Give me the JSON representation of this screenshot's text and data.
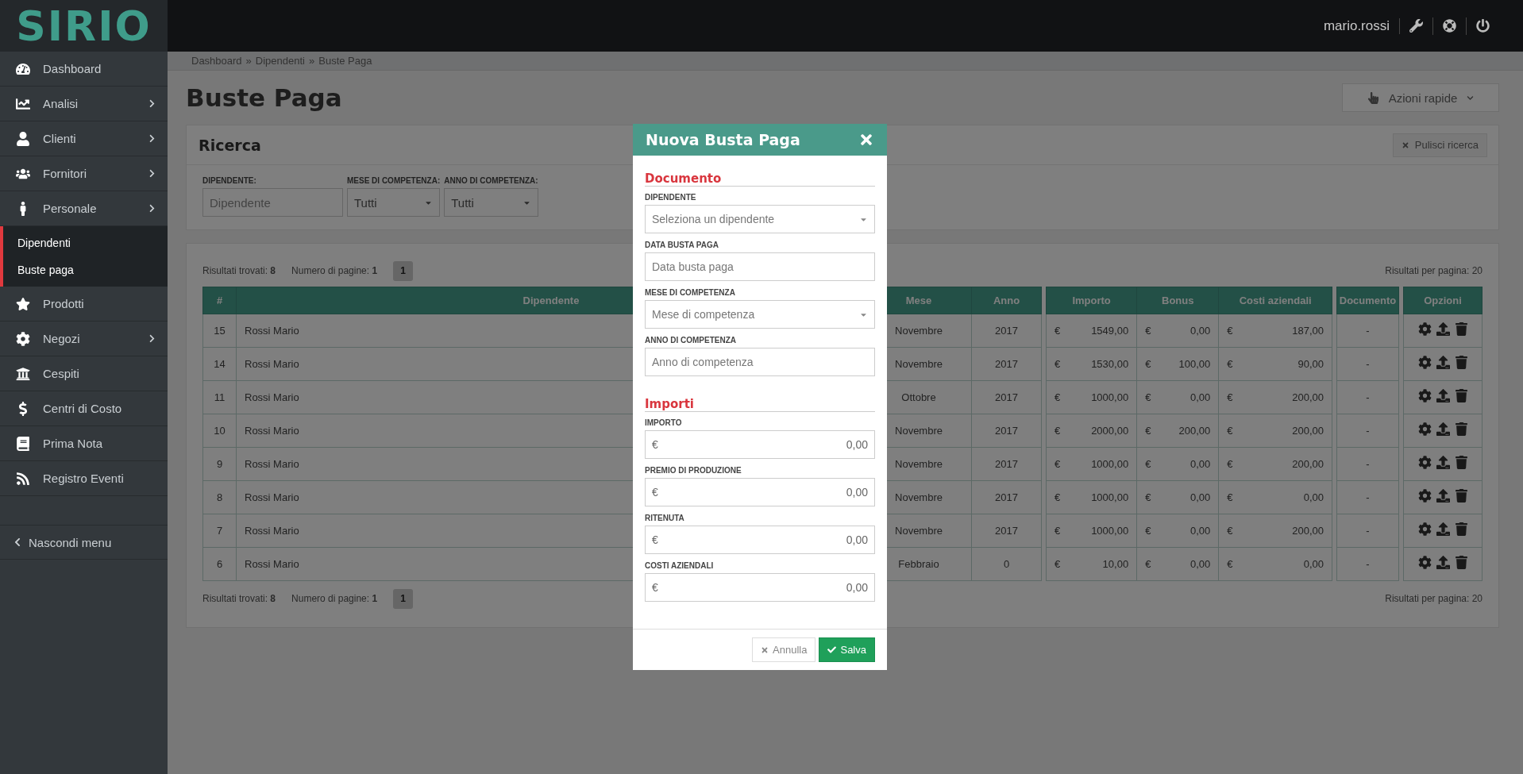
{
  "header": {
    "logo": "SIRIO",
    "user": "mario.rossi"
  },
  "sidebar": {
    "items": [
      {
        "label": "Dashboard",
        "kind": "link"
      },
      {
        "label": "Analisi",
        "kind": "group"
      },
      {
        "label": "Clienti",
        "kind": "group"
      },
      {
        "label": "Fornitori",
        "kind": "group"
      },
      {
        "label": "Personale",
        "kind": "group",
        "children": [
          {
            "label": "Dipendenti"
          },
          {
            "label": "Buste paga"
          }
        ]
      },
      {
        "label": "Prodotti",
        "kind": "link"
      },
      {
        "label": "Negozi",
        "kind": "group"
      },
      {
        "label": "Cespiti",
        "kind": "link"
      },
      {
        "label": "Centri di Costo",
        "kind": "link"
      },
      {
        "label": "Prima Nota",
        "kind": "link"
      },
      {
        "label": "Registro Eventi",
        "kind": "link"
      }
    ],
    "hide_menu": "Nascondi menu"
  },
  "breadcrumb": [
    "Dashboard",
    "Dipendenti",
    "Buste Paga"
  ],
  "breadcrumb_separator": "»",
  "page_title": "Buste Paga",
  "quick_actions": "Azioni rapide",
  "search_panel": {
    "title": "Ricerca",
    "clear_button": "Pulisci ricerca",
    "filters": [
      {
        "label": "DIPENDENTE:",
        "kind": "text",
        "placeholder": "Dipendente"
      },
      {
        "label": "MESE DI COMPETENZA:",
        "kind": "select",
        "value": "Tutti"
      },
      {
        "label": "ANNO DI COMPETENZA:",
        "kind": "select",
        "value": "Tutti"
      }
    ]
  },
  "results_top": {
    "found": "Risultati trovati: **8**",
    "pages": "Numero di pagine: **1**",
    "page_buttons": [
      {
        "label": "1",
        "selected": true
      }
    ],
    "per_page": "Risultati per pagina: 20"
  },
  "table": {
    "groups": [
      [
        "#",
        "Dipendente",
        "Mese",
        "Anno"
      ],
      [
        "Importo",
        "Bonus",
        "Costi aziendali"
      ],
      [
        "Documento"
      ],
      [
        "Opzioni"
      ]
    ],
    "rows": [
      {
        "id": "15",
        "dipendente": "Rossi Mario",
        "mese": "Novembre",
        "anno": "2017",
        "importo": {
          "currency": "€",
          "amount": "1549,00"
        },
        "bonus": {
          "currency": "€",
          "amount": "0,00"
        },
        "costi": {
          "currency": "€",
          "amount": "187,00"
        },
        "documento": "-"
      },
      {
        "id": "14",
        "dipendente": "Rossi Mario",
        "mese": "Novembre",
        "anno": "2017",
        "importo": {
          "currency": "€",
          "amount": "1530,00"
        },
        "bonus": {
          "currency": "€",
          "amount": "100,00"
        },
        "costi": {
          "currency": "€",
          "amount": "90,00"
        },
        "documento": "-"
      },
      {
        "id": "11",
        "dipendente": "Rossi Mario",
        "mese": "Ottobre",
        "anno": "2017",
        "importo": {
          "currency": "€",
          "amount": "1000,00"
        },
        "bonus": {
          "currency": "€",
          "amount": "0,00"
        },
        "costi": {
          "currency": "€",
          "amount": "200,00"
        },
        "documento": "-"
      },
      {
        "id": "10",
        "dipendente": "Rossi Mario",
        "mese": "Novembre",
        "anno": "2017",
        "importo": {
          "currency": "€",
          "amount": "2000,00"
        },
        "bonus": {
          "currency": "€",
          "amount": "200,00"
        },
        "costi": {
          "currency": "€",
          "amount": "200,00"
        },
        "documento": "-"
      },
      {
        "id": "9",
        "dipendente": "Rossi Mario",
        "mese": "Novembre",
        "anno": "2017",
        "importo": {
          "currency": "€",
          "amount": "1000,00"
        },
        "bonus": {
          "currency": "€",
          "amount": "0,00"
        },
        "costi": {
          "currency": "€",
          "amount": "200,00"
        },
        "documento": "-"
      },
      {
        "id": "8",
        "dipendente": "Rossi Mario",
        "mese": "Novembre",
        "anno": "2017",
        "importo": {
          "currency": "€",
          "amount": "1000,00"
        },
        "bonus": {
          "currency": "€",
          "amount": "0,00"
        },
        "costi": {
          "currency": "€",
          "amount": "0,00"
        },
        "documento": "-"
      },
      {
        "id": "7",
        "dipendente": "Rossi Mario",
        "mese": "Novembre",
        "anno": "2017",
        "importo": {
          "currency": "€",
          "amount": "1000,00"
        },
        "bonus": {
          "currency": "€",
          "amount": "0,00"
        },
        "costi": {
          "currency": "€",
          "amount": "200,00"
        },
        "documento": "-"
      },
      {
        "id": "6",
        "dipendente": "Rossi Mario",
        "mese": "Febbraio",
        "anno": "0",
        "importo": {
          "currency": "€",
          "amount": "10,00"
        },
        "bonus": {
          "currency": "€",
          "amount": "0,00"
        },
        "costi": {
          "currency": "€",
          "amount": "0,00"
        },
        "documento": "-"
      }
    ]
  },
  "results_bottom": {
    "found": "Risultati trovati: **8**",
    "pages": "Numero di pagine: **1**",
    "page_buttons": [
      {
        "label": "1",
        "selected": true
      }
    ],
    "per_page": "Risultati per pagina: 20"
  },
  "modal": {
    "title": "Nuova Busta Paga",
    "sections": [
      {
        "title": "Documento",
        "fields": [
          {
            "label": "DIPENDENTE",
            "kind": "select",
            "placeholder": "Seleziona un dipendente"
          },
          {
            "label": "DATA BUSTA PAGA",
            "kind": "text",
            "placeholder": "Data busta paga"
          },
          {
            "label": "MESE DI COMPETENZA",
            "kind": "select",
            "placeholder": "Mese di competenza"
          },
          {
            "label": "ANNO DI COMPETENZA",
            "kind": "text",
            "placeholder": "Anno di competenza"
          }
        ]
      },
      {
        "title": "Importi",
        "fields": [
          {
            "label": "IMPORTO",
            "kind": "currency",
            "prefix": "€",
            "value": "0,00"
          },
          {
            "label": "PREMIO DI PRODUZIONE",
            "kind": "currency",
            "prefix": "€",
            "value": "0,00"
          },
          {
            "label": "RITENUTA",
            "kind": "currency",
            "prefix": "€",
            "value": "0,00"
          },
          {
            "label": "COSTI AZIENDALI",
            "kind": "currency",
            "prefix": "€",
            "value": "0,00"
          }
        ]
      }
    ],
    "cancel": "Annulla",
    "save": "Salva"
  }
}
